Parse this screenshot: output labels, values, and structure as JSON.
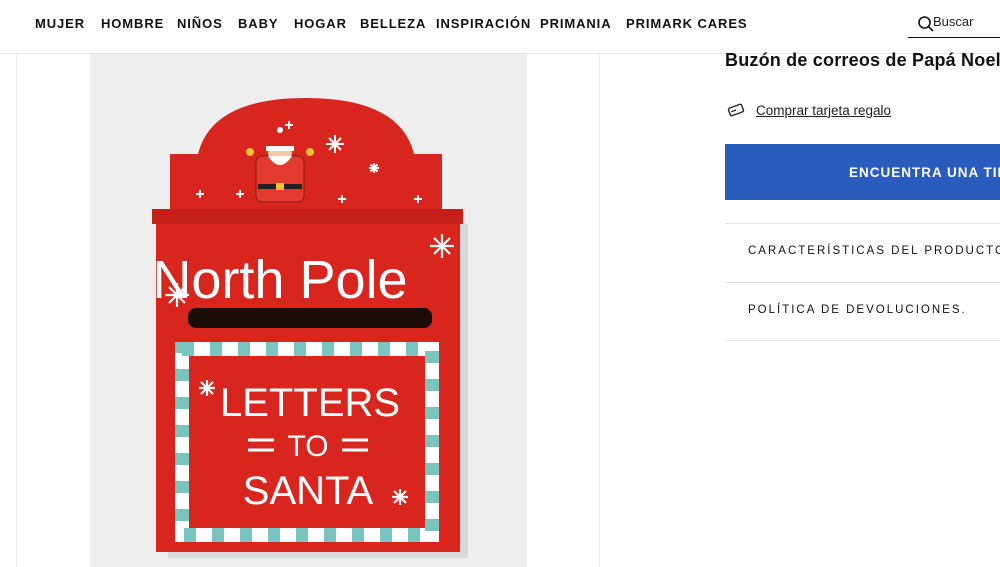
{
  "nav": {
    "items": [
      "MUJER",
      "HOMBRE",
      "NIÑOS",
      "BABY",
      "HOGAR",
      "BELLEZA",
      "INSPIRACIÓN",
      "PRIMANIA",
      "PRIMARK CARES"
    ]
  },
  "search": {
    "placeholder": "Buscar"
  },
  "gallery": {
    "image_alt": "Buzón de correos de Papá Noel",
    "box_texts": {
      "top": "North Pole",
      "middle1": "LETTERS",
      "middle2": "TO",
      "bottom": "SANTA"
    }
  },
  "product": {
    "title": "Buzón de correos de Papá Noel",
    "gift_card_label": "Comprar tarjeta regalo",
    "store_button_label": "ENCUENTRA UNA TIENDA",
    "accordion": [
      "CARACTERÍSTICAS DEL PRODUCTO",
      "POLÍTICA DE DEVOLUCIONES."
    ]
  },
  "colors": {
    "store_button": "#2a5cbd",
    "mailbox_red": "#d8261f"
  },
  "icons": {
    "search": "search-icon",
    "gift_card": "gift-card-icon",
    "store": "location-pin-icon"
  }
}
